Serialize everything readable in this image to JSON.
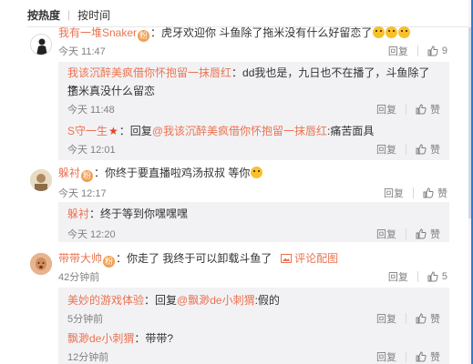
{
  "sort": {
    "hot": "按热度",
    "sep": "|",
    "time": "按时间"
  },
  "comments": [
    {
      "user": "我有一堆Snaker",
      "badge": "粉",
      "text": "虎牙欢迎你 斗鱼除了拖米没有什么好留恋了",
      "time": "今天 11:47",
      "reply": "回复",
      "likes": "9",
      "subs": [
        {
          "user": "我该沉醉美疯借你怀抱留一抹唇红",
          "text": "dd我也是，九日也不在播了，斗鱼除了拖米真没什么留恋",
          "text2": "了",
          "time": "今天 11:48",
          "reply": "回复",
          "like": "赞"
        },
        {
          "user": "S守一生",
          "mid": "回复",
          "at": "@我该沉醉美疯借你怀抱留一抹唇红",
          "text": ":痛苦面具",
          "time": "今天 12:01",
          "reply": "回复",
          "like": "赞"
        }
      ]
    },
    {
      "user": "躲衬",
      "badge": "粉",
      "text": "你终于要直播啦鸡汤叔叔 等你",
      "time": "今天 12:17",
      "reply": "回复",
      "like": "赞",
      "subs": [
        {
          "user": "躲衬",
          "text": "终于等到你嘿嘿嘿",
          "time": "今天 12:20",
          "reply": "回复",
          "like": "赞"
        }
      ]
    },
    {
      "user": "带带大帅",
      "badge": "粉",
      "text": "你走了 我终于可以卸载斗鱼了",
      "pic_link": "评论配图",
      "time": "42分钟前",
      "reply": "回复",
      "likes": "5",
      "subs": [
        {
          "user": "美妙的游戏体验",
          "mid": "回复",
          "at": "@飘渺de小刺猬",
          "text": ":假的",
          "time": "5分钟前",
          "reply": "回复",
          "like": "赞"
        },
        {
          "user": "飘渺de小刺猬",
          "text": "带带?",
          "time": "12分钟前",
          "reply": "回复",
          "like": "赞"
        }
      ]
    }
  ]
}
